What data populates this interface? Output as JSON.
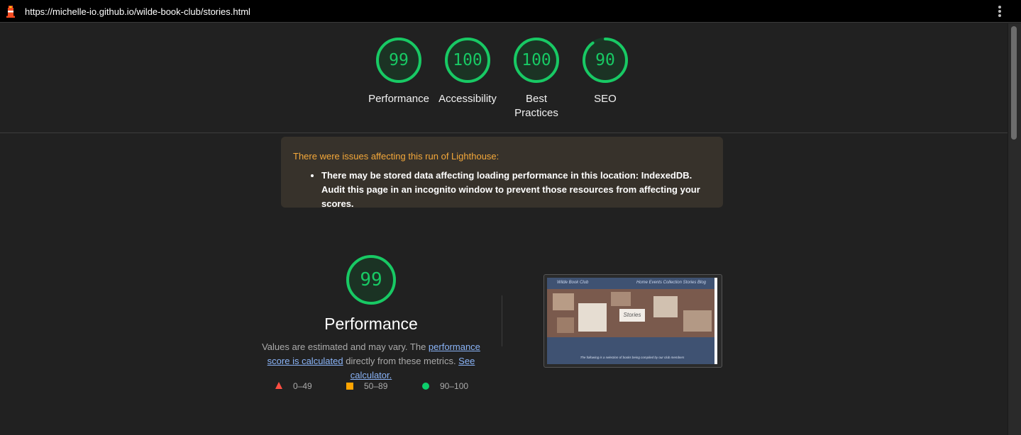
{
  "browser": {
    "url": "https://michelle-io.github.io/wilde-book-club/stories.html"
  },
  "gauges": [
    {
      "score": "99",
      "label": "Performance",
      "fraction": 0.99
    },
    {
      "score": "100",
      "label": "Accessibility",
      "fraction": 1.0
    },
    {
      "score": "100",
      "label": "Best Practices",
      "fraction": 1.0
    },
    {
      "score": "90",
      "label": "SEO",
      "fraction": 0.9
    }
  ],
  "warning": {
    "title": "There were issues affecting this run of Lighthouse:",
    "item": "There may be stored data affecting loading performance in this location: IndexedDB. Audit this page in an incognito window to prevent those resources from affecting your scores."
  },
  "performance": {
    "score": "99",
    "fraction": 0.99,
    "title": "Performance",
    "desc_prefix": "Values are estimated and may vary. The ",
    "link1": "performance score is calculated",
    "desc_middle": " directly from these metrics. ",
    "link2": "See calculator."
  },
  "legend": [
    {
      "range": "0–49",
      "shape": "triangle",
      "color": "#ff4e42"
    },
    {
      "range": "50–89",
      "shape": "square",
      "color": "#ffa400"
    },
    {
      "range": "90–100",
      "shape": "circle",
      "color": "#0cce6b"
    }
  ],
  "screenshot": {
    "brand": "Wilde Book Club",
    "nav_links": "Home   Events   Collection   Stories   Blog",
    "hero_label": "Stories",
    "caption": "The following is a selection of books being compiled by our club members"
  },
  "colors": {
    "pass": "#18c964",
    "warning_title": "#f4a83a",
    "link": "#8ab4f8"
  }
}
